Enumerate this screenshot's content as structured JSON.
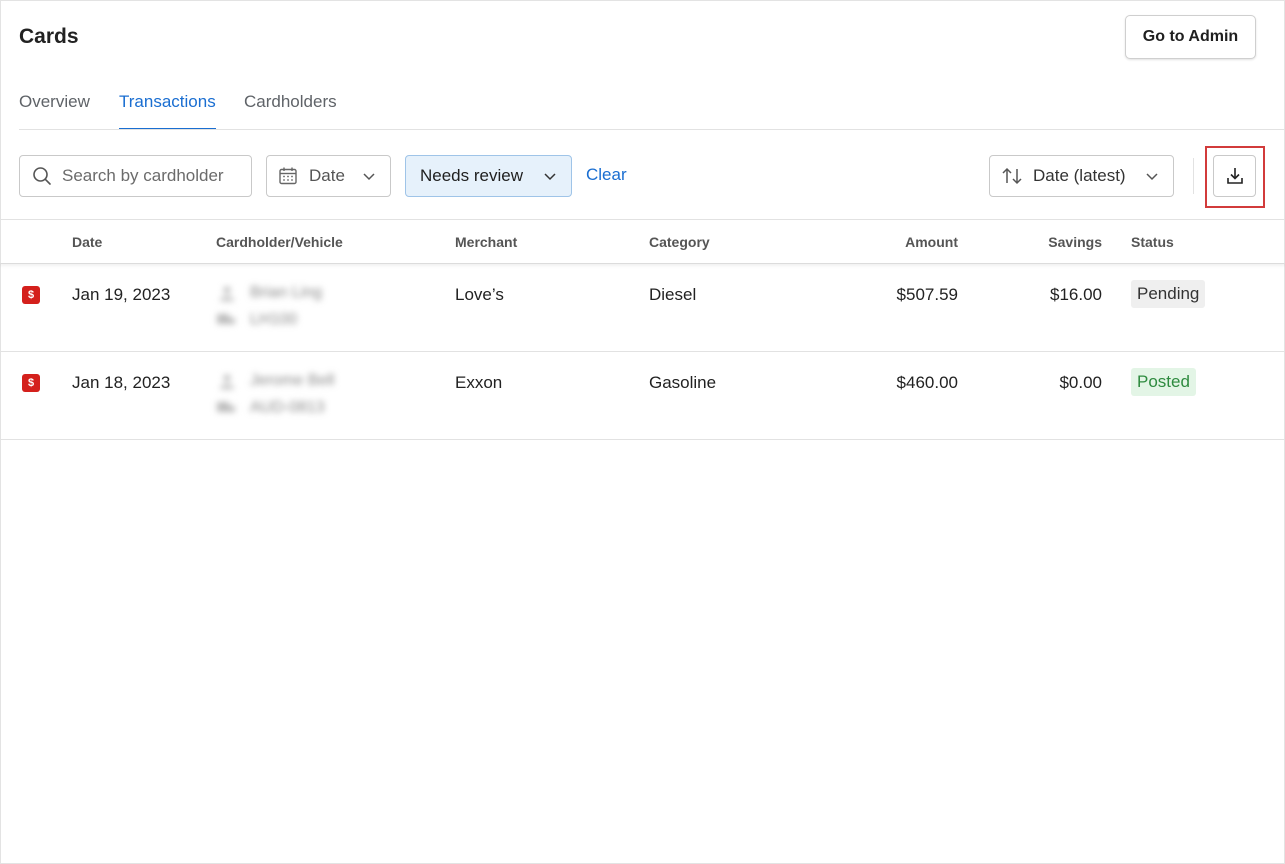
{
  "header": {
    "title": "Cards",
    "admin_button": "Go to Admin"
  },
  "tabs": [
    {
      "label": "Overview",
      "active": false
    },
    {
      "label": "Transactions",
      "active": true
    },
    {
      "label": "Cardholders",
      "active": false
    }
  ],
  "filters": {
    "search_placeholder": "Search by cardholder",
    "date_label": "Date",
    "status_label": "Needs review",
    "clear_label": "Clear",
    "sort_label": "Date (latest)"
  },
  "table": {
    "columns": [
      "Date",
      "Cardholder/Vehicle",
      "Merchant",
      "Category",
      "Amount",
      "Savings",
      "Status"
    ],
    "rows": [
      {
        "date": "Jan 19, 2023",
        "cardholder": "Brian Ling",
        "vehicle": "LH100",
        "merchant": "Love’s",
        "category": "Diesel",
        "amount": "$507.59",
        "savings": "$16.00",
        "status": "Pending"
      },
      {
        "date": "Jan 18, 2023",
        "cardholder": "Jerome Bell",
        "vehicle": "AUD-0813",
        "merchant": "Exxon",
        "category": "Gasoline",
        "amount": "$460.00",
        "savings": "$0.00",
        "status": "Posted"
      }
    ]
  },
  "icons": {
    "card_icon_glyph": "$",
    "accent": "#1a6ed1",
    "card_red": "#d4201c"
  }
}
